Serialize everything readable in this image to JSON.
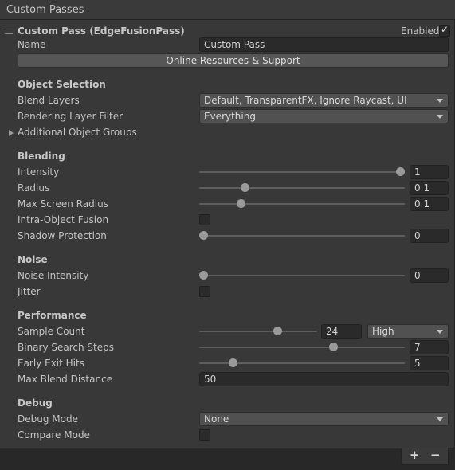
{
  "window": {
    "title": "Custom Passes"
  },
  "pass": {
    "header_title": "Custom Pass (EdgeFusionPass)",
    "enabled_label": "Enabled",
    "enabled": true,
    "name_label": "Name",
    "name_value": "Custom Pass",
    "resources_button": "Online Resources & Support"
  },
  "object_selection": {
    "header": "Object Selection",
    "blend_layers_label": "Blend Layers",
    "blend_layers_value": "Default, TransparentFX, Ignore Raycast, UI",
    "rendering_layer_label": "Rendering Layer Filter",
    "rendering_layer_value": "Everything",
    "additional_groups_label": "Additional Object Groups"
  },
  "blending": {
    "header": "Blending",
    "intensity_label": "Intensity",
    "intensity_value": "1",
    "intensity_fraction": 1.0,
    "radius_label": "Radius",
    "radius_value": "0.1",
    "radius_fraction": 0.21,
    "max_screen_radius_label": "Max Screen Radius",
    "max_screen_radius_value": "0.1",
    "max_screen_radius_fraction": 0.19,
    "intra_object_label": "Intra-Object Fusion",
    "intra_object_checked": false,
    "shadow_protection_label": "Shadow Protection",
    "shadow_protection_value": "0",
    "shadow_protection_fraction": 0.0
  },
  "noise": {
    "header": "Noise",
    "noise_intensity_label": "Noise Intensity",
    "noise_intensity_value": "0",
    "noise_intensity_fraction": 0.0,
    "jitter_label": "Jitter",
    "jitter_checked": false
  },
  "performance": {
    "header": "Performance",
    "sample_count_label": "Sample Count",
    "sample_count_value": "24",
    "sample_count_fraction": 0.68,
    "quality_preset": "High",
    "binary_search_label": "Binary Search Steps",
    "binary_search_value": "7",
    "binary_search_fraction": 0.66,
    "early_exit_label": "Early Exit Hits",
    "early_exit_value": "5",
    "early_exit_fraction": 0.15,
    "max_blend_distance_label": "Max Blend Distance",
    "max_blend_distance_value": "50"
  },
  "debug": {
    "header": "Debug",
    "debug_mode_label": "Debug Mode",
    "debug_mode_value": "None",
    "compare_mode_label": "Compare Mode",
    "compare_mode_checked": false
  },
  "footer": {
    "add_label": "+",
    "remove_label": "−"
  },
  "colors": {
    "panel": "#383838",
    "field": "#2a2a2a",
    "dropdown": "#515151",
    "thumb": "#9a9a9a"
  }
}
